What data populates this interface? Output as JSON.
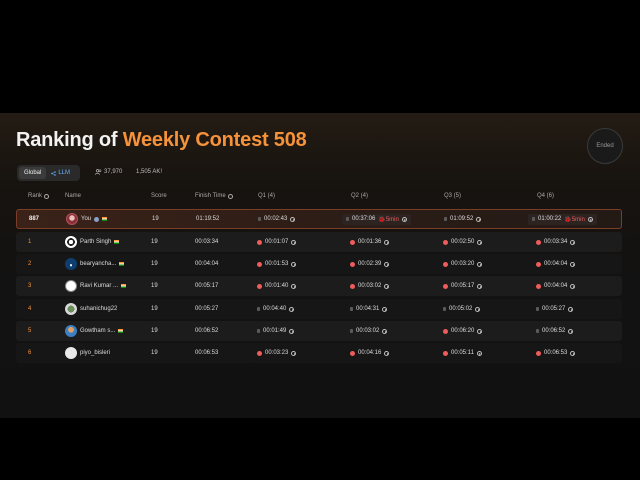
{
  "contest": {
    "title_prefix": "Ranking of ",
    "title_accent": "Weekly Contest 508",
    "status_badge": "Ended"
  },
  "filters": {
    "global_label": "Global",
    "llm_label": "LLM"
  },
  "stats": {
    "participants": "37,970",
    "ak": "1,505 AK!"
  },
  "columns": {
    "rank": "Rank",
    "name": "Name",
    "score": "Score",
    "finish_time": "Finish Time",
    "q1": "Q1 (4)",
    "q2": "Q2 (4)",
    "q3": "Q3 (5)",
    "q4": "Q4 (6)"
  },
  "rows": [
    {
      "rank": "887",
      "name": "You",
      "score": "19",
      "finish": "01:19:52",
      "q1": {
        "time": "00:02:43",
        "status": "grey"
      },
      "q2": {
        "time": "00:37:06",
        "status": "grey",
        "penalty": "5min"
      },
      "q3": {
        "time": "01:09:52",
        "status": "grey"
      },
      "q4": {
        "time": "01:00:22",
        "status": "grey",
        "penalty": "5min"
      }
    },
    {
      "rank": "1",
      "name": "Parth Singh",
      "score": "19",
      "finish": "00:03:34",
      "q1": {
        "time": "00:01:07",
        "status": "red"
      },
      "q2": {
        "time": "00:01:36",
        "status": "red"
      },
      "q3": {
        "time": "00:02:50",
        "status": "red"
      },
      "q4": {
        "time": "00:03:34",
        "status": "red"
      }
    },
    {
      "rank": "2",
      "name": "bearyancha...",
      "score": "19",
      "finish": "00:04:04",
      "q1": {
        "time": "00:01:53",
        "status": "red"
      },
      "q2": {
        "time": "00:02:39",
        "status": "red"
      },
      "q3": {
        "time": "00:03:20",
        "status": "red"
      },
      "q4": {
        "time": "00:04:04",
        "status": "red"
      }
    },
    {
      "rank": "3",
      "name": "Ravi Kumar ...",
      "score": "19",
      "finish": "00:05:17",
      "q1": {
        "time": "00:01:40",
        "status": "red"
      },
      "q2": {
        "time": "00:03:02",
        "status": "red"
      },
      "q3": {
        "time": "00:05:17",
        "status": "red"
      },
      "q4": {
        "time": "00:04:04",
        "status": "red"
      }
    },
    {
      "rank": "4",
      "name": "suhanichug22",
      "score": "19",
      "finish": "00:05:27",
      "q1": {
        "time": "00:04:40",
        "status": "grey"
      },
      "q2": {
        "time": "00:04:31",
        "status": "grey"
      },
      "q3": {
        "time": "00:05:02",
        "status": "grey"
      },
      "q4": {
        "time": "00:05:27",
        "status": "grey"
      }
    },
    {
      "rank": "5",
      "name": "Gowtham s...",
      "score": "19",
      "finish": "00:06:52",
      "q1": {
        "time": "00:01:49",
        "status": "grey"
      },
      "q2": {
        "time": "00:03:02",
        "status": "grey"
      },
      "q3": {
        "time": "00:06:20",
        "status": "red"
      },
      "q4": {
        "time": "00:06:52",
        "status": "grey"
      }
    },
    {
      "rank": "6",
      "name": "piyo_bisleri",
      "score": "19",
      "finish": "00:06:53",
      "q1": {
        "time": "00:03:23",
        "status": "red"
      },
      "q2": {
        "time": "00:04:16",
        "status": "red"
      },
      "q3": {
        "time": "00:05:11",
        "status": "red"
      },
      "q4": {
        "time": "00:06:53",
        "status": "red"
      }
    }
  ],
  "colors": {
    "accent": "#f5923a",
    "ac_dot": "#ef5c5c",
    "highlight_border": "#7a3d27",
    "llm": "#6ab0ff"
  }
}
